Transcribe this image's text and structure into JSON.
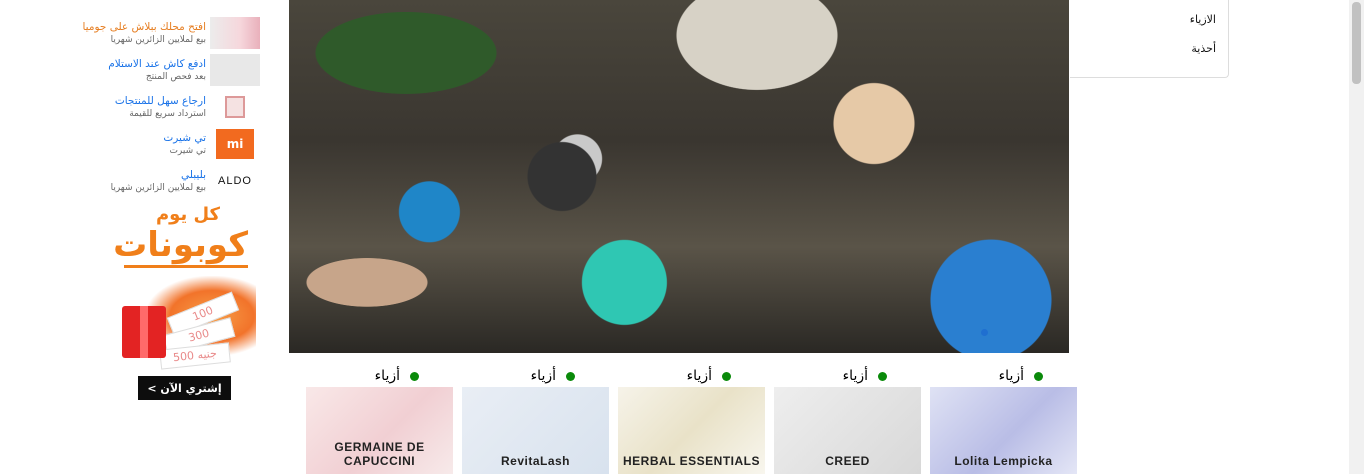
{
  "promos": [
    {
      "title": "افتح محلك ببلاش على جوميا",
      "subtitle": "بيع لملايين الزائرين شهريا",
      "title_color": "#e67e22",
      "thumb": "store-banner"
    },
    {
      "title": "ادفع كاش عند الاستلام",
      "subtitle": "بعد فحص المنتج",
      "title_color": "#1a73e8",
      "thumb": "perfume-box"
    },
    {
      "title": "ارجاع سهل للمنتجات",
      "subtitle": "استرداد سريع للقيمة",
      "title_color": "#1a73e8",
      "thumb": "perfume-bottle"
    },
    {
      "title": "تي شيرت",
      "subtitle": "تي شيرت",
      "title_color": "#1a73e8",
      "thumb": "mi-logo",
      "thumb_text": "mi"
    },
    {
      "title": "بليبلي",
      "subtitle": "بيع لملايين الزائرين شهريا",
      "title_color": "#1a73e8",
      "thumb": "aldo-logo",
      "thumb_text": "ALDO"
    }
  ],
  "coupon": {
    "top": "كل يوم",
    "main": "كوبونات",
    "tickets": [
      "100",
      "300",
      "500 جنيه"
    ],
    "button": "إشتري الآن >"
  },
  "category_menu": [
    "الازياء",
    "أحذية"
  ],
  "products": [
    {
      "category": "أزياء",
      "brand": "GERMAINE DE CAPUCCINI"
    },
    {
      "category": "أزياء",
      "brand": "RevitaLash"
    },
    {
      "category": "أزياء",
      "brand": "HERBAL ESSENTIALS"
    },
    {
      "category": "أزياء",
      "brand": "CREED"
    },
    {
      "category": "أزياء",
      "brand": "Lolita Lempicka"
    }
  ]
}
